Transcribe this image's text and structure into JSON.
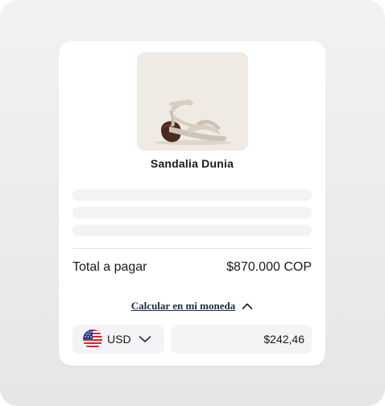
{
  "product": {
    "name": "Sandalia Dunia",
    "image_icon": "sandal-product-image"
  },
  "summary": {
    "total_label": "Total a pagar",
    "total_value": "$870.000 COP"
  },
  "converter": {
    "toggle_label": "Calcular en mi moneda",
    "toggle_icon": "chevron-up-icon",
    "currency_code": "USD",
    "currency_flag": "us-flag-icon",
    "dropdown_icon": "chevron-down-icon",
    "converted_amount": "$242,46"
  },
  "colors": {
    "link": "#1f2a4d",
    "field_bg": "#f4f4f6",
    "image_bg": "#efeae4"
  }
}
